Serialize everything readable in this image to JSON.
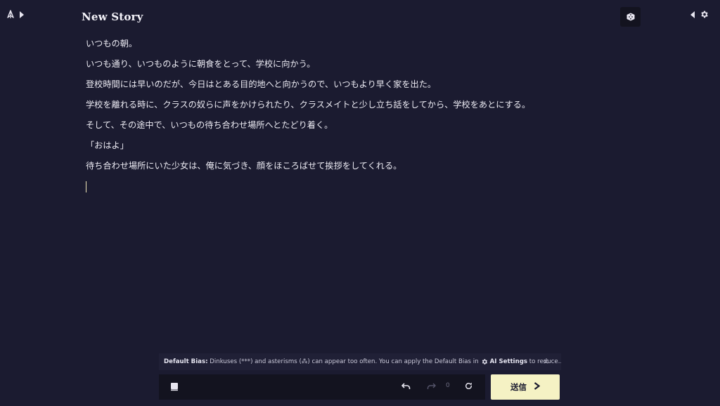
{
  "header": {
    "title": "New Story",
    "left_icons": [
      "logo-icon",
      "expand-right-icon"
    ],
    "right_icons": [
      "dice-icon",
      "collapse-left-icon",
      "gear-icon"
    ]
  },
  "story": {
    "paragraphs": [
      "いつもの朝。",
      "いつも通り、いつものように朝食をとって、学校に向かう。",
      "登校時間には早いのだが、今日はとある目的地へと向かうので、いつもより早く家を出た。",
      "学校を離れる時に、クラスの奴らに声をかけられたり、クラスメイトと少し立ち話をしてから、学校をあとにする。",
      "そして、その途中で、いつもの待ち合わせ場所へとたどり着く。",
      "「おはよ」",
      "待ち合わせ場所にいた少女は、俺に気づき、顔をほころばせて挨拶をしてくれる。"
    ]
  },
  "notice": {
    "label": "Default Bias:",
    "text": "Dinkuses (***) and asterisms (⁂) can appear too often. You can apply the Default Bias in",
    "link": "AI Settings",
    "suffix": "to reduce…",
    "close": "×"
  },
  "toolbar": {
    "redo_count": "0",
    "send_label": "送信"
  },
  "colors": {
    "background": "#1b1b30",
    "panel": "#13131f",
    "accent": "#f5f2c4",
    "caret": "#f0e6b8"
  }
}
